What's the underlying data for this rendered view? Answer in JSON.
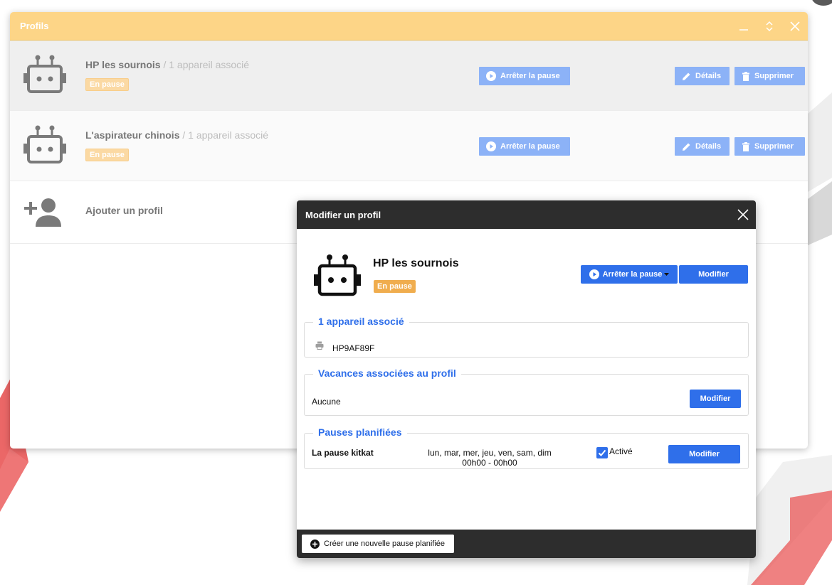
{
  "colors": {
    "header_accent": "#fdd587",
    "primary_blue": "#2f6fea",
    "badge_orange": "#f0ad4e",
    "modal_dark": "#2d2d2d"
  },
  "window": {
    "title": "Profils",
    "controls": [
      "minimize-icon",
      "expand-icon",
      "close-icon"
    ]
  },
  "profiles": [
    {
      "name": "HP les sournois",
      "subtitle": "/ 1 appareil associé",
      "badge": "En pause",
      "pause_button": "Arrêter la pause",
      "details_button": "Détails",
      "delete_button": "Supprimer",
      "icon": "robot-icon"
    },
    {
      "name": "L'aspirateur chinois",
      "subtitle": "/ 1 appareil associé",
      "badge": "En pause",
      "pause_button": "Arrêter la pause",
      "details_button": "Détails",
      "delete_button": "Supprimer",
      "icon": "robot-icon"
    }
  ],
  "add_profile": {
    "label": "Ajouter un profil",
    "icon": "add-user-icon"
  },
  "modal": {
    "title": "Modifier un profil",
    "profile_name": "HP les sournois",
    "badge": "En pause",
    "pause_button": "Arrêter la pause",
    "modify_button": "Modifier",
    "devices": {
      "legend": "1 appareil associé",
      "items": [
        {
          "name": "HP9AF89F",
          "icon": "printer-icon"
        }
      ]
    },
    "vacations": {
      "legend": "Vacances associées au profil",
      "value": "Aucune",
      "modify_button": "Modifier"
    },
    "scheduled_pauses": {
      "legend": "Pauses planifiées",
      "items": [
        {
          "name": "La pause kitkat",
          "days": "lun, mar, mer, jeu, ven, sam, dim",
          "hours": "00h00 - 00h00",
          "active_label": "Activé",
          "active": true,
          "modify_button": "Modifier"
        }
      ]
    },
    "footer_button": "Créer une nouvelle pause planifiée"
  }
}
